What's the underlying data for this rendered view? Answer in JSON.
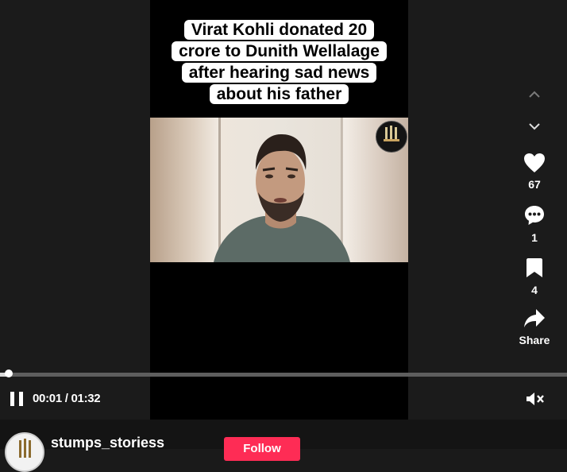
{
  "video": {
    "caption_lines": [
      "Virat Kohli donated 20",
      "crore to Dunith Wellalage",
      "after hearing sad news",
      "about his father"
    ],
    "watermark_text": "STUMPS & STORIES"
  },
  "actions": {
    "likes": "67",
    "comments": "1",
    "saves": "4",
    "share_label": "Share"
  },
  "player": {
    "current_time": "00:01",
    "separator": " / ",
    "duration": "01:32",
    "progress_fraction": 0.011
  },
  "author": {
    "username": "stumps_storiess",
    "follow_label": "Follow"
  },
  "colors": {
    "accent": "#fe2c55",
    "background": "#1a1a1a"
  },
  "icons": [
    "chevron-up-icon",
    "chevron-down-icon",
    "heart-icon",
    "comment-icon",
    "bookmark-icon",
    "share-icon",
    "pause-icon",
    "mute-icon"
  ]
}
